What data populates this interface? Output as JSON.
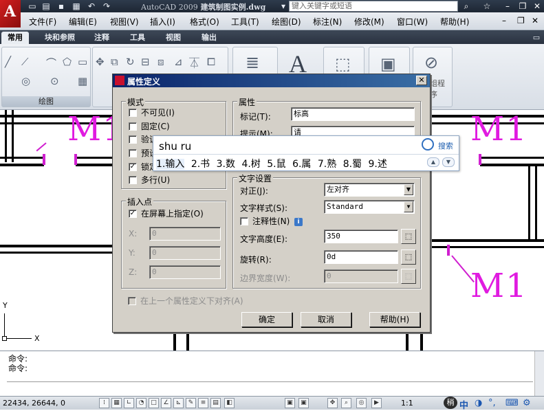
{
  "titlebar": {
    "app_name": "AutoCAD 2009",
    "document": "建筑制图实例.dwg",
    "search_placeholder": "键入关键字或短语",
    "logo_letter": "A"
  },
  "menu": [
    "文件(F)",
    "编辑(E)",
    "视图(V)",
    "插入(I)",
    "格式(O)",
    "工具(T)",
    "绘图(D)",
    "标注(N)",
    "修改(M)",
    "窗口(W)",
    "帮助(H)"
  ],
  "ribbon_tabs": [
    "常用",
    "块和参照",
    "注释",
    "工具",
    "视图",
    "输出"
  ],
  "ribbon": {
    "draw_panel_label": "绘图",
    "right_panel_text": "组程序"
  },
  "drawing": {
    "door_labels": [
      "M1",
      "M1",
      "M1"
    ],
    "ucs_x": "X",
    "ucs_y": "Y"
  },
  "dialog": {
    "title": "属性定义",
    "close": "✕",
    "mode_group": "模式",
    "modes": [
      {
        "label": "不可见(I)",
        "checked": false
      },
      {
        "label": "固定(C)",
        "checked": false
      },
      {
        "label": "验证",
        "checked": false
      },
      {
        "label": "预设",
        "checked": false
      },
      {
        "label": "锁定",
        "checked": true
      },
      {
        "label": "多行(U)",
        "checked": false
      }
    ],
    "attr_group": "属性",
    "tag_label": "标记(T):",
    "tag_value": "标高",
    "prompt_label": "提示(M):",
    "prompt_value": "请",
    "insert_group": "插入点",
    "on_screen_label": "在屏幕上指定(O)",
    "on_screen_checked": true,
    "x_label": "X:",
    "y_label": "Y:",
    "z_label": "Z:",
    "x_value": "0",
    "y_value": "0",
    "z_value": "0",
    "text_group": "文字设置",
    "justify_label": "对正(J):",
    "justify_value": "左对齐",
    "style_label": "文字样式(S):",
    "style_value": "Standard",
    "annotative_label": "注释性(N)",
    "height_label": "文字高度(E):",
    "height_value": "350",
    "rotation_label": "旋转(R):",
    "rotation_value": "0d",
    "width_label": "边界宽度(W):",
    "width_value": "0",
    "align_below_label": "在上一个属性定义下对齐(A)",
    "ok": "确定",
    "cancel": "取消",
    "help": "帮助(H)"
  },
  "ime": {
    "input": "shu ru",
    "search": "搜索",
    "candidates": [
      "1.输入",
      "2.书",
      "3.数",
      "4.树",
      "5.鼠",
      "6.属",
      "7.熟",
      "8.蜀",
      "9.述"
    ]
  },
  "command": {
    "lines": [
      "命令:",
      "命令:"
    ]
  },
  "status": {
    "coords": "22434, 26644, 0",
    "scale": "1:1"
  }
}
